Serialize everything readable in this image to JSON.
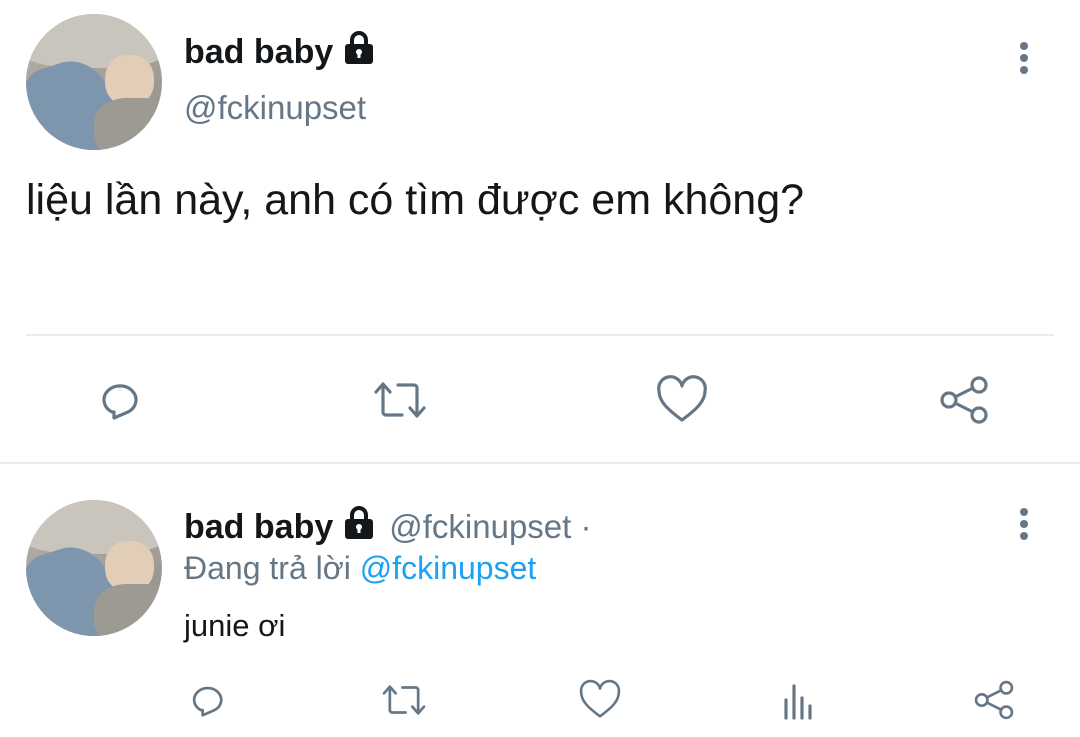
{
  "main_tweet": {
    "display_name": "bad baby",
    "handle": "@fckinupset",
    "text": "liệu lần này, anh có tìm được em không?"
  },
  "reply": {
    "display_name": "bad baby",
    "handle": "@fckinupset ·",
    "replying_prefix": "Đang trả lời",
    "replying_to": "@fckinupset",
    "text": "junie ơi"
  },
  "icons": {
    "lock": "lock-icon",
    "more": "more-icon",
    "reply": "reply-icon",
    "retweet": "retweet-icon",
    "like": "heart-icon",
    "share": "share-icon",
    "analytics": "analytics-icon"
  },
  "colors": {
    "text": "#14171a",
    "secondary": "#657786",
    "link": "#1da1f2",
    "divider": "#e6ecf0"
  }
}
